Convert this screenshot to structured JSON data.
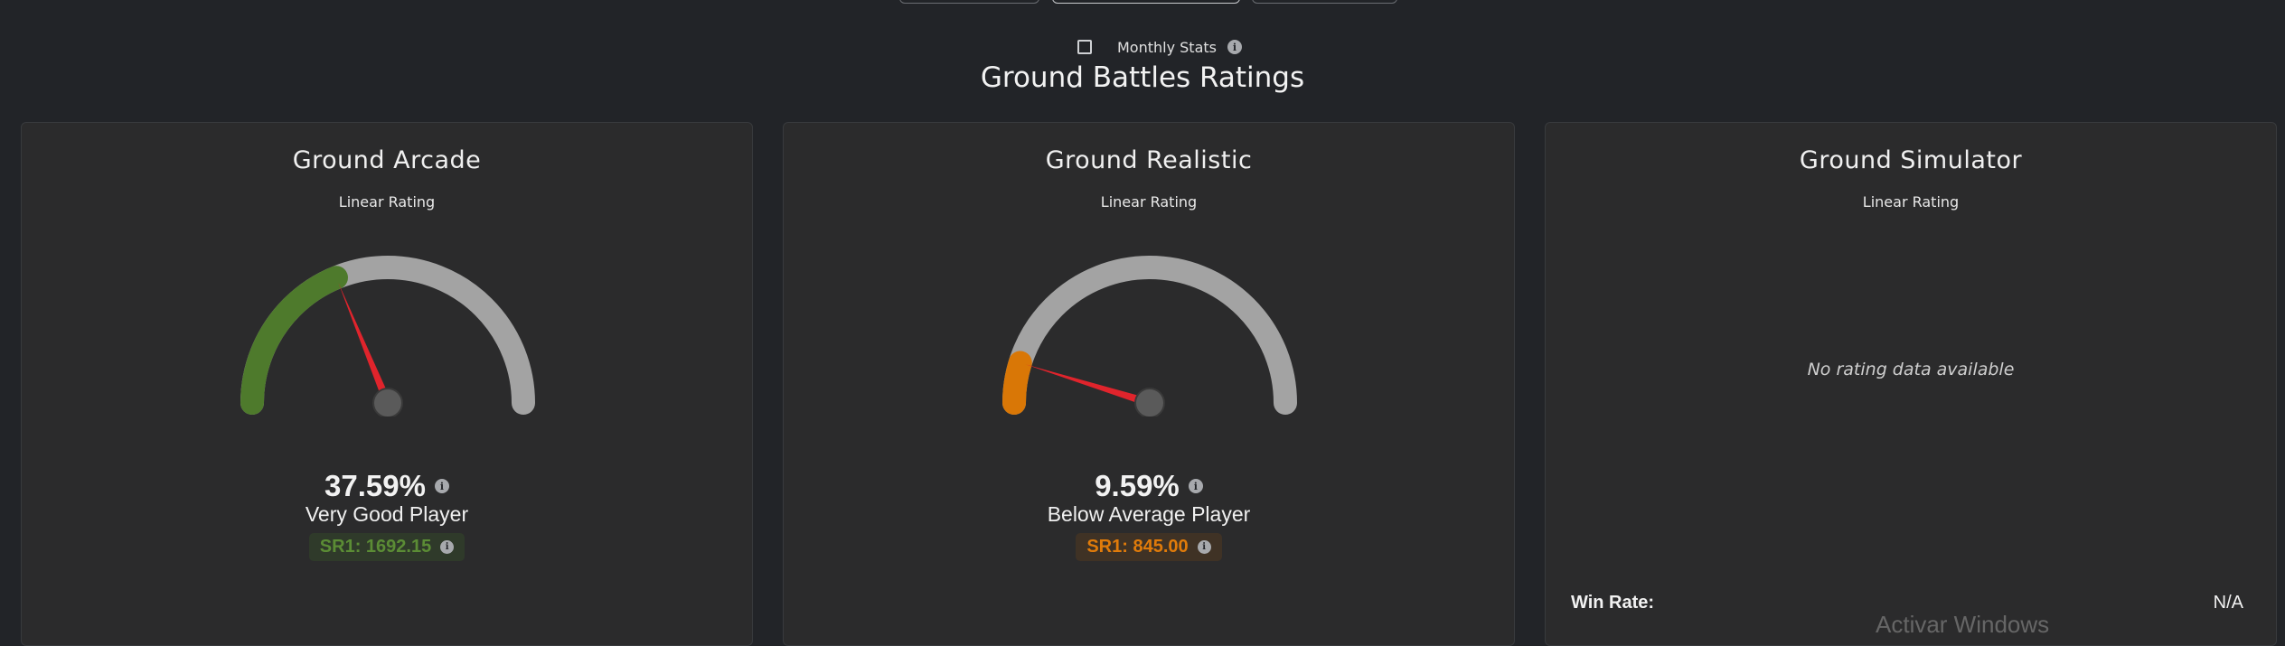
{
  "monthly_stats": {
    "label": "Monthly Stats",
    "info_glyph": "i",
    "checked": false
  },
  "page_title": "Ground Battles Ratings",
  "cards": [
    {
      "title": "Ground Arcade",
      "subtitle": "Linear Rating",
      "percent": "37.59%",
      "percent_value": 37.59,
      "rating_label": "Very Good Player",
      "sr": "SR1: 1692.15",
      "color": "#4e7a2c",
      "badge": "green"
    },
    {
      "title": "Ground Realistic",
      "subtitle": "Linear Rating",
      "percent": "9.59%",
      "percent_value": 9.59,
      "rating_label": "Below Average Player",
      "sr": "SR1: 845.00",
      "color": "#d97706",
      "badge": "orange"
    },
    {
      "title": "Ground Simulator",
      "subtitle": "Linear Rating",
      "no_data": "No rating data available",
      "win_rate_label": "Win Rate:",
      "win_rate_value": "N/A"
    }
  ],
  "colors": {
    "track": "#a3a3a3",
    "needle": "#e0242c",
    "hub": "#5a5a5a"
  },
  "info_glyph": "i",
  "watermark": "Activar Windows"
}
